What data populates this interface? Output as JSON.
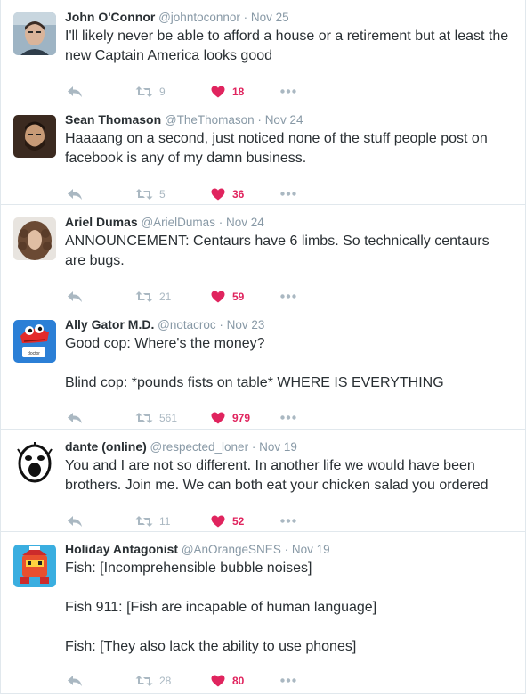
{
  "tweets": [
    {
      "name": "John O'Connor",
      "handle": "@johntoconnor",
      "time": "Nov 25",
      "lines": [
        "I'll likely never be able to afford a house or a retirement but at least the",
        "new Captain America looks good"
      ],
      "retweets": "9",
      "likes": "18",
      "avatar": "avatar-man-portrait"
    },
    {
      "name": "Sean Thomason",
      "handle": "@TheThomason",
      "time": "Nov 24",
      "lines": [
        "Haaaang on a second, just noticed none of the stuff people post on",
        "facebook is any of my damn business."
      ],
      "retweets": "5",
      "likes": "36",
      "avatar": "avatar-bearded-man"
    },
    {
      "name": "Ariel Dumas",
      "handle": "@ArielDumas",
      "time": "Nov 24",
      "lines": [
        "ANNOUNCEMENT: Centaurs have 6 limbs. So technically centaurs",
        "are bugs."
      ],
      "retweets": "21",
      "likes": "59",
      "avatar": "avatar-curly-hair"
    },
    {
      "name": "Ally Gator M.D.",
      "handle": "@notacroc",
      "time": "Nov 23",
      "lines": [
        "Good cop: Where's the money?",
        "",
        "Blind cop: *pounds fists on table* WHERE IS EVERYTHING"
      ],
      "retweets": "561",
      "likes": "979",
      "avatar": "avatar-cartoon-gator",
      "avatar_text": "doctor"
    },
    {
      "name": "dante (online)",
      "handle": "@respected_loner",
      "time": "Nov 19",
      "lines": [
        "You and I are not so different. In another life we would have been",
        "brothers. Join me. We can both eat your chicken salad you ordered"
      ],
      "retweets": "11",
      "likes": "52",
      "avatar": "avatar-screaming-face"
    },
    {
      "name": "Holiday Antagonist",
      "handle": "@AnOrangeSNES",
      "time": "Nov 19",
      "lines": [
        "Fish: [Incomprehensible bubble noises]",
        "",
        "Fish 911: [Fish are incapable of human language]",
        "",
        "Fish: [They also lack the ability to use phones]"
      ],
      "retweets": "28",
      "likes": "80",
      "avatar": "avatar-red-robot"
    }
  ],
  "colors": {
    "like": "#e0245e",
    "icon": "#aab8c2",
    "meta": "#8899a6",
    "border": "#e1e8ed",
    "text": "#292f33"
  },
  "separator": "·"
}
